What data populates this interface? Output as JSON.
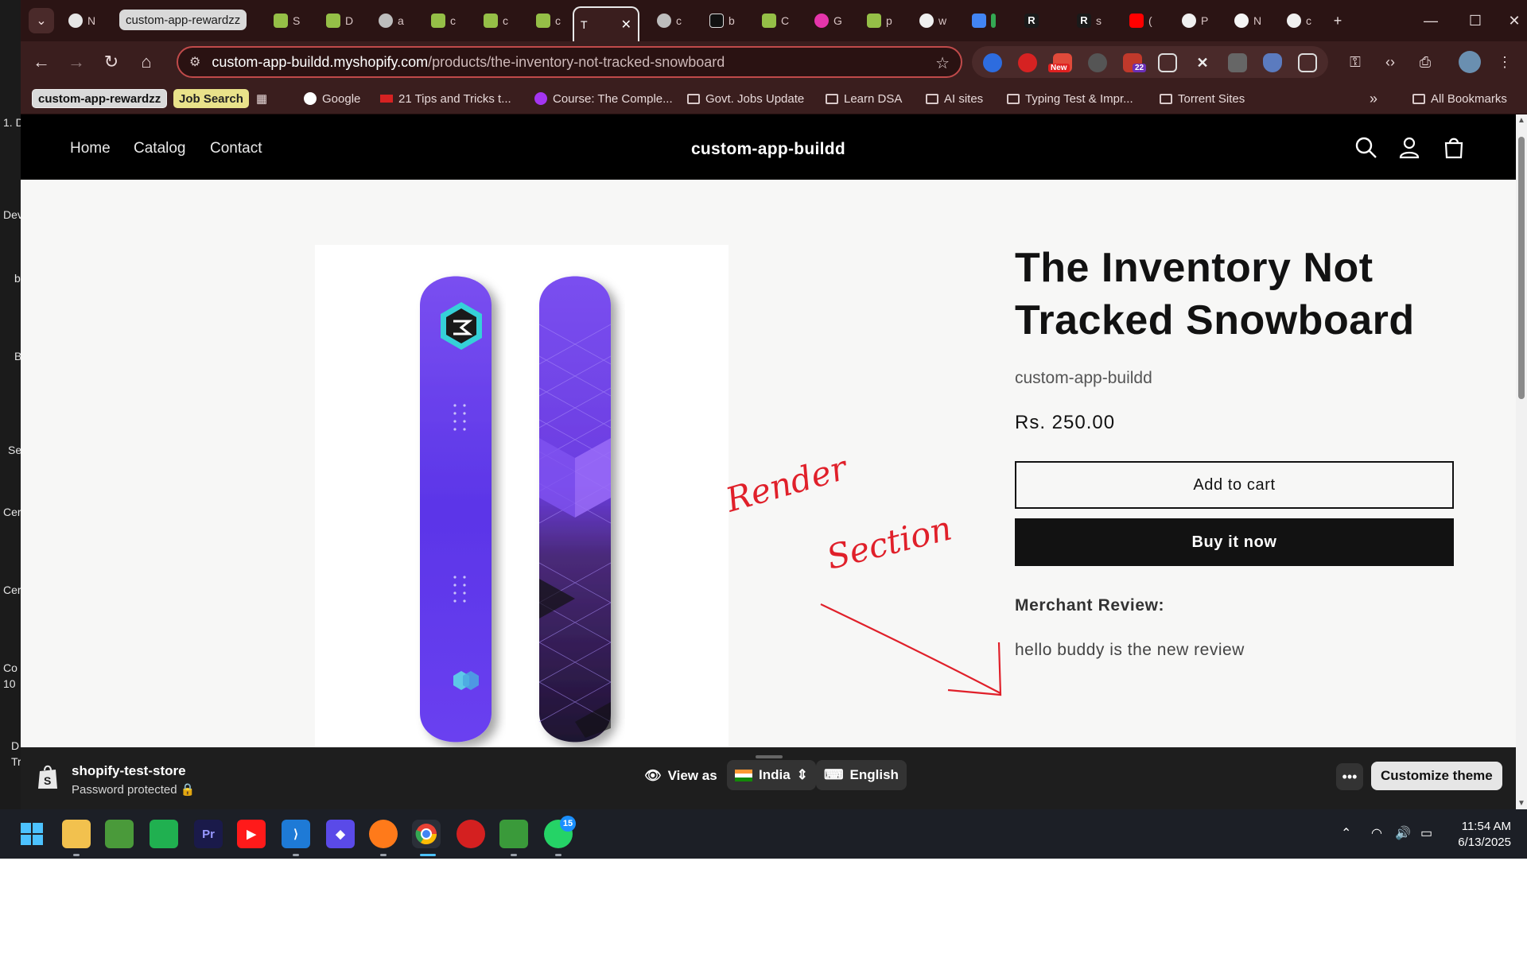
{
  "side_window": {
    "labels": [
      "1. D",
      "Dev",
      "b",
      "B",
      "Se",
      "Cer",
      "Cer",
      "Co",
      "10",
      "D",
      "Tr"
    ]
  },
  "browser": {
    "tab_group_label": "custom-app-rewardzz",
    "tabs": [
      {
        "label": "N",
        "icon": "chrome-icon"
      },
      {
        "label": "S",
        "icon": "shopify-icon"
      },
      {
        "label": "D",
        "icon": "shopify-icon"
      },
      {
        "label": "a",
        "icon": "globe-icon"
      },
      {
        "label": "c",
        "icon": "shopify-icon"
      },
      {
        "label": "c",
        "icon": "shopify-icon"
      },
      {
        "label": "c",
        "icon": "shopify-icon"
      },
      {
        "label": "T",
        "icon": "tab-icon",
        "active": true
      },
      {
        "label": "c",
        "icon": "globe-icon"
      },
      {
        "label": "b",
        "icon": "atom-icon"
      },
      {
        "label": "C",
        "icon": "shopify-icon"
      },
      {
        "label": "G",
        "icon": "graphql-icon"
      },
      {
        "label": "p",
        "icon": "shopify-icon"
      },
      {
        "label": "w",
        "icon": "github-icon"
      },
      {
        "label": "",
        "icon": "docs-icon"
      },
      {
        "label": "",
        "icon": "r-icon"
      },
      {
        "label": "s",
        "icon": "r-icon"
      },
      {
        "label": "(",
        "icon": "youtube-icon"
      },
      {
        "label": "P",
        "icon": "github-icon"
      },
      {
        "label": "N",
        "icon": "openai-icon"
      },
      {
        "label": "c",
        "icon": "github-icon"
      }
    ],
    "url": "custom-app-buildd.myshopify.com/products/the-inventory-not-tracked-snowboard",
    "url_host": "custom-app-buildd.myshopify.com",
    "url_path": "/products/the-inventory-not-tracked-snowboard",
    "ext_badges": {
      "new": "New",
      "count": "22"
    },
    "bookmarks": {
      "chip_group": "custom-app-rewardzz",
      "chip_job": "Job Search",
      "items": [
        "Google",
        "21 Tips and Tricks t...",
        "Course: The Comple...",
        "Govt. Jobs Update",
        "Learn DSA",
        "AI sites",
        "Typing Test & Impr...",
        "Torrent Sites"
      ],
      "overflow": "»",
      "all": "All Bookmarks"
    }
  },
  "store": {
    "nav": [
      "Home",
      "Catalog",
      "Contact"
    ],
    "name": "custom-app-buildd"
  },
  "product": {
    "title": "The Inventory Not Tracked Snowboard",
    "vendor": "custom-app-buildd",
    "price": "Rs. 250.00",
    "add_to_cart": "Add to cart",
    "buy_now": "Buy it now",
    "review_heading": "Merchant Review:",
    "review_text": "hello buddy is the new review"
  },
  "annotation": {
    "text_1": "Render",
    "text_2": "Section",
    "color": "#e0202a"
  },
  "preview_bar": {
    "store": "shopify-test-store",
    "protection": "Password protected",
    "view_as": "View as",
    "country": "India",
    "language": "English",
    "customize": "Customize theme"
  },
  "taskbar": {
    "time": "11:54 AM",
    "date": "6/13/2025",
    "whatsapp_badge": "15"
  },
  "colors": {
    "accent_red": "#c04a4a",
    "browser_frame": "#3a1e1e",
    "board_purple": "#5b35e8"
  }
}
